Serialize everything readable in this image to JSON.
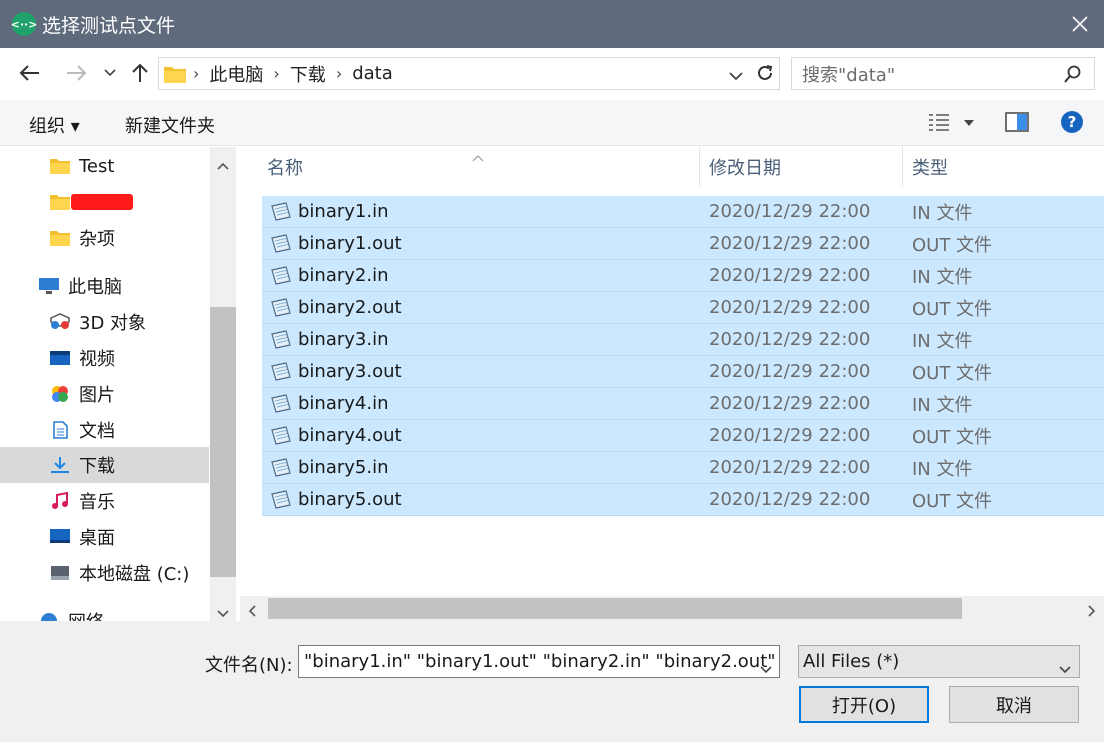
{
  "window": {
    "title": "选择测试点文件",
    "app_icon_glyph": "<··>"
  },
  "address": {
    "crumbs": [
      "此电脑",
      "下载",
      "data"
    ],
    "search_placeholder": "搜索\"data\""
  },
  "toolbar": {
    "organize_label": "组织 ▾",
    "new_folder_label": "新建文件夹"
  },
  "nav": {
    "items": [
      {
        "label": "Test",
        "icon": "folder-icon"
      },
      {
        "label": "",
        "icon": "folder-icon",
        "redacted": true
      },
      {
        "label": "杂项",
        "icon": "folder-icon"
      },
      {
        "label": "此电脑",
        "icon": "computer-icon"
      },
      {
        "label": "3D 对象",
        "icon": "3d-objects-icon"
      },
      {
        "label": "视频",
        "icon": "video-icon"
      },
      {
        "label": "图片",
        "icon": "pictures-icon"
      },
      {
        "label": "文档",
        "icon": "documents-icon"
      },
      {
        "label": "下载",
        "icon": "download-icon",
        "selected": true
      },
      {
        "label": "音乐",
        "icon": "music-icon"
      },
      {
        "label": "桌面",
        "icon": "desktop-icon"
      },
      {
        "label": "本地磁盘 (C:)",
        "icon": "drive-icon"
      },
      {
        "label": "网络",
        "icon": "network-icon"
      }
    ]
  },
  "columns": {
    "name": "名称",
    "modified": "修改日期",
    "type": "类型"
  },
  "files": [
    {
      "name": "binary1.in",
      "modified": "2020/12/29 22:00",
      "type": "IN 文件"
    },
    {
      "name": "binary1.out",
      "modified": "2020/12/29 22:00",
      "type": "OUT 文件"
    },
    {
      "name": "binary2.in",
      "modified": "2020/12/29 22:00",
      "type": "IN 文件"
    },
    {
      "name": "binary2.out",
      "modified": "2020/12/29 22:00",
      "type": "OUT 文件"
    },
    {
      "name": "binary3.in",
      "modified": "2020/12/29 22:00",
      "type": "IN 文件"
    },
    {
      "name": "binary3.out",
      "modified": "2020/12/29 22:00",
      "type": "OUT 文件"
    },
    {
      "name": "binary4.in",
      "modified": "2020/12/29 22:00",
      "type": "IN 文件"
    },
    {
      "name": "binary4.out",
      "modified": "2020/12/29 22:00",
      "type": "OUT 文件"
    },
    {
      "name": "binary5.in",
      "modified": "2020/12/29 22:00",
      "type": "IN 文件"
    },
    {
      "name": "binary5.out",
      "modified": "2020/12/29 22:00",
      "type": "OUT 文件"
    }
  ],
  "footer": {
    "filename_label": "文件名(N):",
    "filename_value": "\"binary1.in\" \"binary1.out\" \"binary2.in\" \"binary2.out\" ",
    "filter_value": "All Files  (*)",
    "open_label": "打开(O)",
    "cancel_label": "取消"
  },
  "colors": {
    "titlebar": "#5f6b7d",
    "selection": "#cce8ff",
    "accent": "#0078d7",
    "folder": "#f2c12e"
  }
}
